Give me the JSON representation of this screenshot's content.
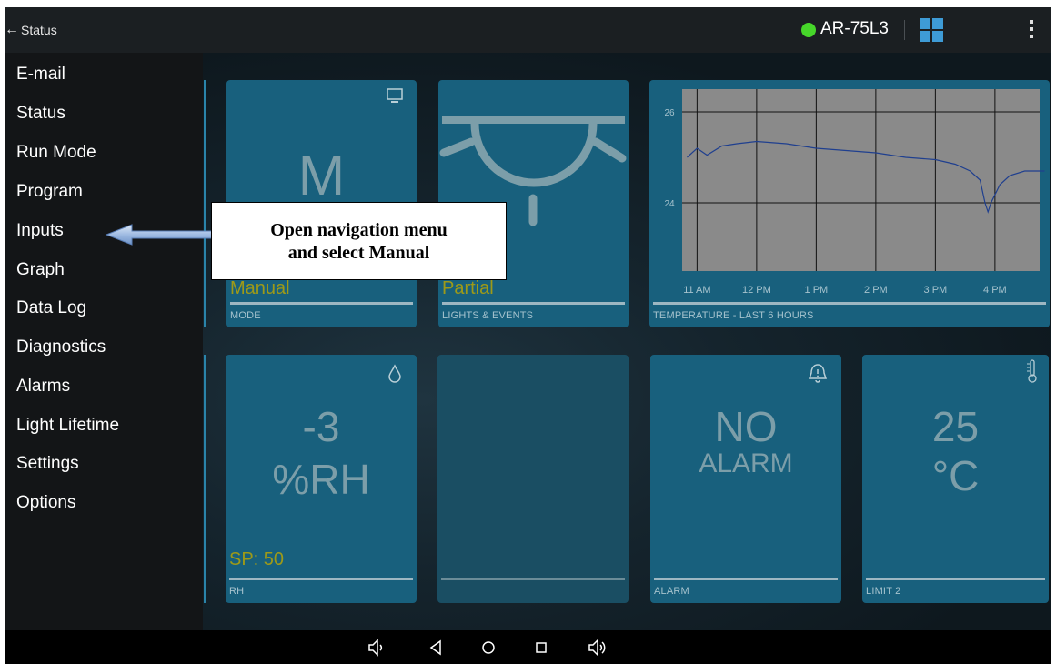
{
  "topbar": {
    "back_label": "Status",
    "device_name": "AR-75L3"
  },
  "nav_menu": {
    "items": [
      "E-mail",
      "Status",
      "Run Mode",
      "Program",
      "Inputs",
      "Graph",
      "Data Log",
      "Diagnostics",
      "Alarms",
      "Light Lifetime",
      "Settings",
      "Options"
    ]
  },
  "callout": {
    "line1": "Open navigation menu",
    "line2": "and select Manual"
  },
  "tiles": {
    "mode": {
      "value": "M",
      "sub": "Manual",
      "footer": "MODE"
    },
    "lights": {
      "sub": "Partial",
      "footer": "LIGHTS & EVENTS"
    },
    "rh": {
      "value": "-3",
      "unit": "%RH",
      "setpoint": "SP: 50",
      "footer": "RH"
    },
    "alarm": {
      "value": "NO",
      "sub": "ALARM",
      "footer": "ALARM"
    },
    "limit2": {
      "value": "25",
      "unit": "°C",
      "footer": "LIMIT 2"
    }
  },
  "chart_data": {
    "type": "line",
    "xlabel": "TEMPERATURE - LAST 6 HOURS",
    "x_ticks": [
      "11 AM",
      "12 PM",
      "1 PM",
      "2 PM",
      "3 PM",
      "4 PM"
    ],
    "y_ticks": [
      24,
      26
    ],
    "ylim": [
      22.5,
      26.5
    ],
    "grid": true,
    "series": [
      {
        "x": [
          "10:50",
          "11:00",
          "11:10",
          "11:25",
          "11:40",
          "12:00",
          "12:30",
          "1:00",
          "1:30",
          "2:00",
          "2:30",
          "3:00",
          "3:20",
          "3:35",
          "3:45",
          "3:50",
          "3:53",
          "3:56",
          "4:05",
          "4:15",
          "4:30",
          "4:50"
        ],
        "values": [
          25.0,
          25.2,
          25.05,
          25.25,
          25.3,
          25.35,
          25.3,
          25.2,
          25.15,
          25.1,
          25.0,
          24.95,
          24.85,
          24.7,
          24.5,
          24.0,
          23.8,
          24.0,
          24.4,
          24.6,
          24.7,
          24.7
        ],
        "color": "#1f3f8f"
      }
    ]
  },
  "colors": {
    "tile": "#18607d",
    "status_ok": "#46d62a",
    "setpoint": "#9e9a18"
  },
  "icons": [
    "back-arrow-icon",
    "status-dot-icon",
    "grid-icon",
    "kebab-menu-icon",
    "monitor-icon",
    "droplet-icon",
    "bell-alert-icon",
    "thermometer-icon",
    "volume-down-icon",
    "back-icon",
    "home-icon",
    "recents-icon",
    "volume-up-icon"
  ]
}
